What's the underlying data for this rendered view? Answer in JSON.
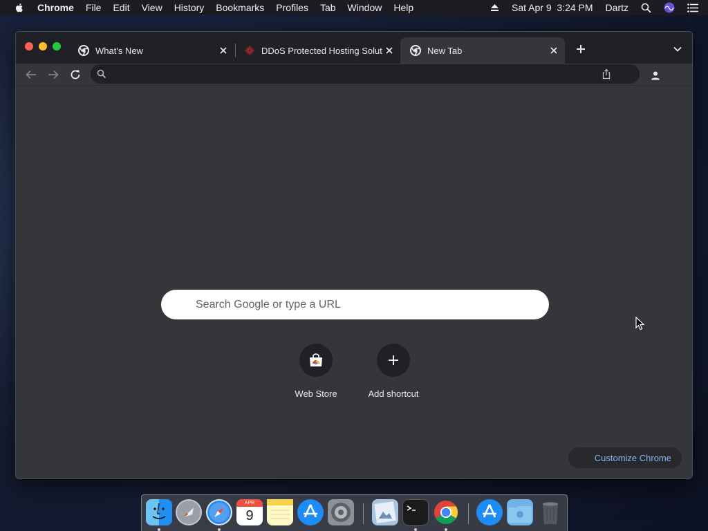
{
  "menubar": {
    "app_name": "Chrome",
    "items": [
      "File",
      "Edit",
      "View",
      "History",
      "Bookmarks",
      "Profiles",
      "Tab",
      "Window",
      "Help"
    ],
    "datetime": "Sat Apr 9  3:24 PM",
    "user": "Dartz"
  },
  "browser": {
    "tabs": [
      {
        "title": "What's New",
        "favicon": "chrome-icon",
        "active": false
      },
      {
        "title": "DDoS Protected Hosting Soluti",
        "favicon": "ddos-site-icon",
        "active": false
      },
      {
        "title": "New Tab",
        "favicon": "chrome-icon",
        "active": true
      }
    ],
    "omnibox": {
      "value": "",
      "placeholder": ""
    }
  },
  "ntp": {
    "search_placeholder": "Search Google or type a URL",
    "shortcuts": [
      {
        "label": "Web Store",
        "icon": "web-store-icon"
      },
      {
        "label": "Add shortcut",
        "icon": "plus-icon"
      }
    ],
    "customize_label": "Customize Chrome"
  },
  "dock": {
    "apps": [
      "Finder",
      "Launchpad",
      "Safari",
      "Calendar",
      "Notes",
      "App Store",
      "System Preferences",
      "Preview",
      "Terminal",
      "Chrome",
      "App Store Downloads",
      "Downloads Folder",
      "Trash"
    ],
    "calendar_month": "APR",
    "calendar_day": "9"
  },
  "colors": {
    "accent_link": "#8ab4f8",
    "window_bg": "#35363a",
    "tabstrip_bg": "#202124"
  }
}
